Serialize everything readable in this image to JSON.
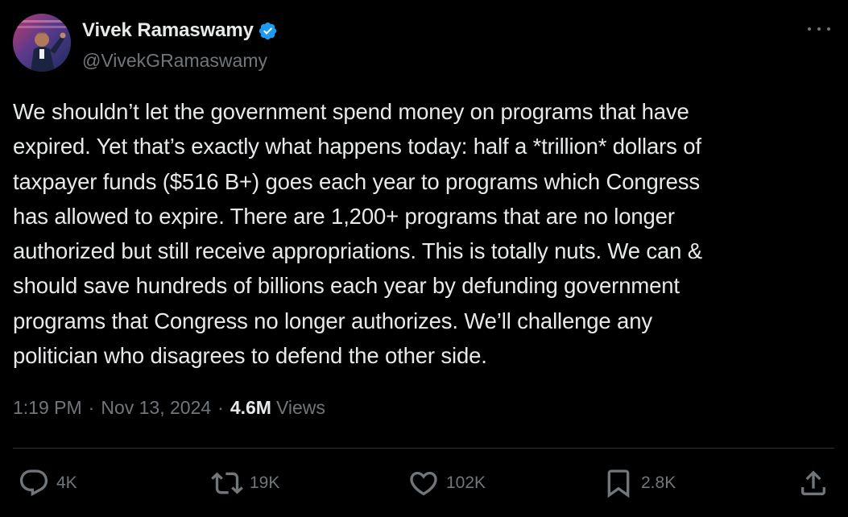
{
  "author": {
    "display_name": "Vivek Ramaswamy",
    "handle": "@VivekGRamaswamy",
    "verified": true,
    "verified_color": "#1d9bf0"
  },
  "tweet": {
    "text": "We shouldn’t let the government spend money on programs that have\nexpired. Yet that’s exactly what happens today: half a *trillion* dollars of\ntaxpayer funds ($516 B+) goes each year to programs which Congress\nhas allowed to expire. There are 1,200+ programs that are no longer\nauthorized but still receive appropriations. This is totally nuts. We can &\nshould save hundreds of billions each year by defunding government\nprograms that Congress no longer authorizes. We’ll challenge any\npolitician who disagrees to defend the other side.",
    "time": "1:19 PM",
    "date": "Nov 13, 2024",
    "separator": "·",
    "views_count": "4.6M",
    "views_label": "Views"
  },
  "actions": {
    "reply": {
      "icon": "reply-icon",
      "count": "4K"
    },
    "repost": {
      "icon": "repost-icon",
      "count": "19K"
    },
    "like": {
      "icon": "heart-icon",
      "count": "102K"
    },
    "bookmark": {
      "icon": "bookmark-icon",
      "count": "2.8K"
    },
    "share": {
      "icon": "share-icon"
    }
  },
  "colors": {
    "background": "#000000",
    "text_primary": "#e7e9ea",
    "text_secondary": "#71767b",
    "divider": "#2f3336"
  }
}
